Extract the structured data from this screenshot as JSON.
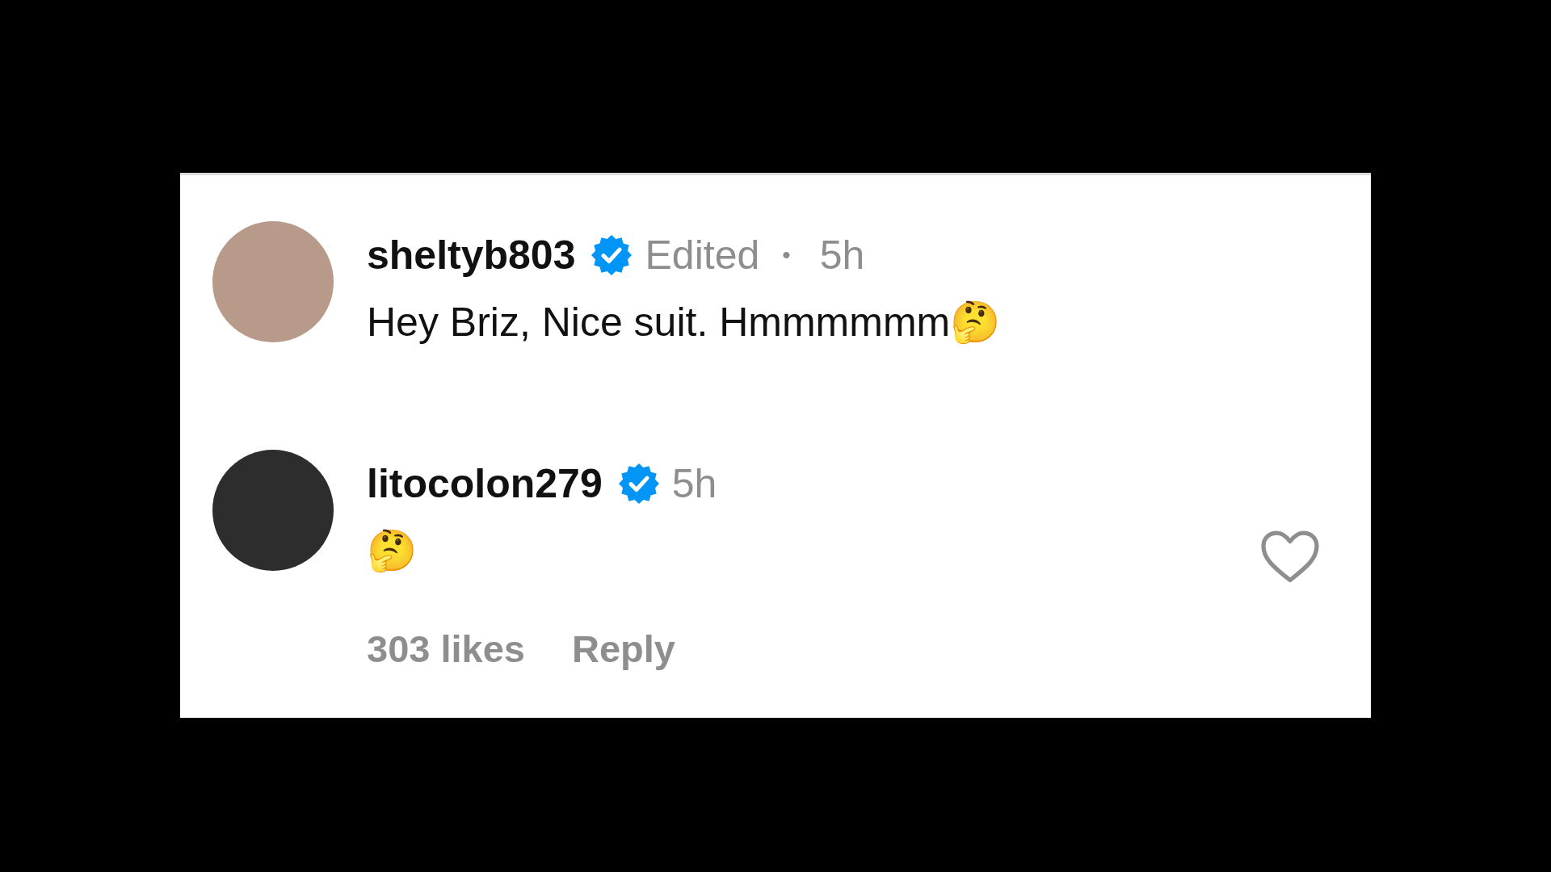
{
  "comments": [
    {
      "username": "sheltyb803",
      "verified": true,
      "edited": "Edited",
      "separator": "•",
      "time": "5h",
      "text": "Hey Briz, Nice suit. Hmmmmmm🤔"
    },
    {
      "username": "litocolon279",
      "verified": true,
      "time": "5h",
      "text": "🤔",
      "likes": "303 likes",
      "reply": "Reply",
      "liked": false
    }
  ]
}
